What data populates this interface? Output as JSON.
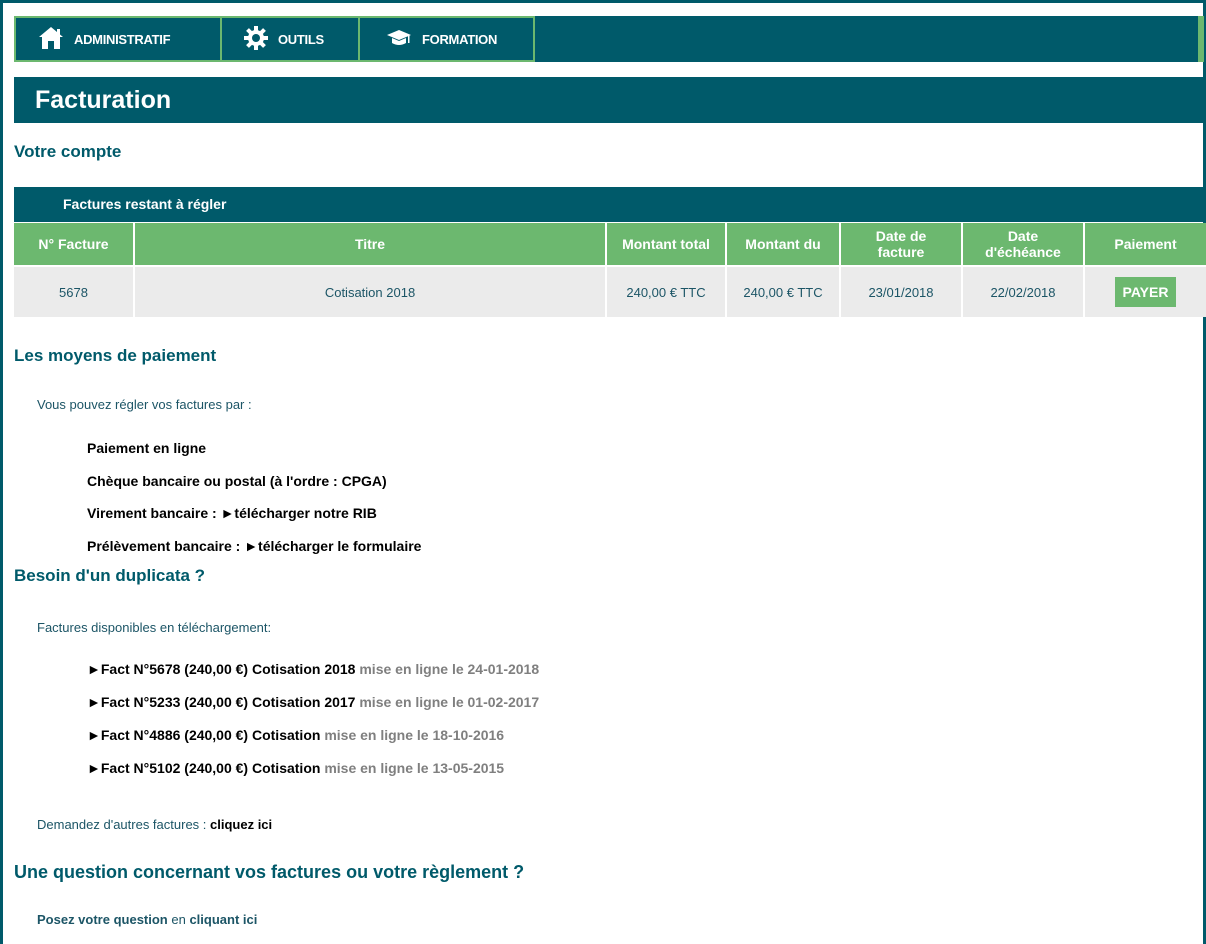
{
  "nav": {
    "items": [
      {
        "label": "ADMINISTRATIF",
        "icon": "home-icon"
      },
      {
        "label": "OUTILS",
        "icon": "gear-icon"
      },
      {
        "label": "FORMATION",
        "icon": "graduation-cap-icon"
      }
    ]
  },
  "page": {
    "title": "Facturation"
  },
  "account": {
    "heading": "Votre compte"
  },
  "invoices_due": {
    "heading": "Factures restant à régler",
    "columns": [
      "N° Facture",
      "Titre",
      "Montant total",
      "Montant du",
      "Date de facture",
      "Date d'échéance",
      "Paiement"
    ],
    "rows": [
      {
        "number": "5678",
        "title": "Cotisation 2018",
        "total": "240,00 € TTC",
        "due": "240,00 € TTC",
        "date": "23/01/2018",
        "deadline": "22/02/2018",
        "pay_label": "PAYER"
      }
    ]
  },
  "payment_methods": {
    "heading": "Les moyens de paiement",
    "intro": "Vous pouvez régler vos factures par :",
    "online": "Paiement en ligne",
    "cheque": "Chèque bancaire ou postal (à l'ordre : CPGA)",
    "transfer_label": "Virement bancaire : ",
    "transfer_link": "►télécharger notre RIB",
    "debit_label": "Prélèvement bancaire : ",
    "debit_link": "►télécharger le formulaire"
  },
  "duplicates": {
    "heading": "Besoin d'un duplicata ?",
    "intro": "Factures disponibles en téléchargement:",
    "items": [
      {
        "link": "►Fact N°5678 (240,00 €) Cotisation 2018",
        "date": " mise en ligne le 24-01-2018"
      },
      {
        "link": "►Fact N°5233 (240,00 €) Cotisation 2017",
        "date": " mise en ligne le 01-02-2017"
      },
      {
        "link": "►Fact N°4886 (240,00 €) Cotisation",
        "date": " mise en ligne le 18-10-2016"
      },
      {
        "link": "►Fact N°5102 (240,00 €) Cotisation",
        "date": " mise en ligne le 13-05-2015"
      }
    ],
    "other_text": "Demandez d'autres factures : ",
    "other_link": "cliquez ici"
  },
  "question": {
    "heading": "Une question concernant vos factures ou votre règlement ?",
    "link1": "Posez votre question",
    "middle": " en ",
    "link2": "cliquant ici"
  },
  "colors": {
    "primary": "#005a6a",
    "accent": "#6cb86f",
    "row_bg": "#ebebeb"
  }
}
